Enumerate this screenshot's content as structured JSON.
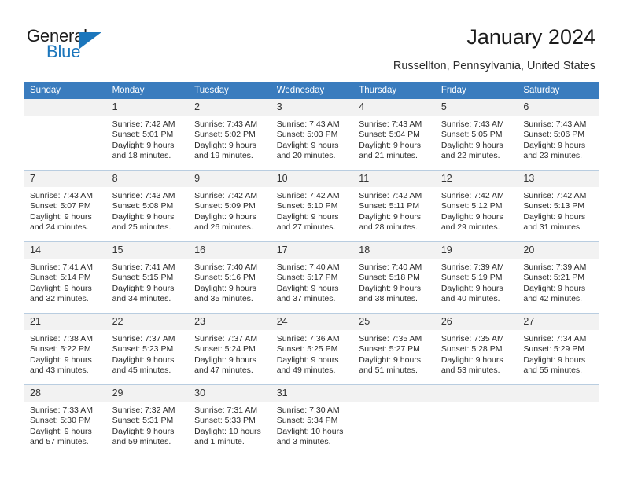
{
  "brand": {
    "name_part1": "General",
    "name_part2": "Blue",
    "logo_icon": "triangle-logo-icon",
    "accent_color": "#1b76bc"
  },
  "header": {
    "title": "January 2024",
    "location": "Russellton, Pennsylvania, United States"
  },
  "calendar": {
    "header_color": "#3a7cbe",
    "weekdays": [
      "Sunday",
      "Monday",
      "Tuesday",
      "Wednesday",
      "Thursday",
      "Friday",
      "Saturday"
    ],
    "weeks": [
      [
        {
          "day": "",
          "sunrise": "",
          "sunset": "",
          "daylight1": "",
          "daylight2": ""
        },
        {
          "day": "1",
          "sunrise": "Sunrise: 7:42 AM",
          "sunset": "Sunset: 5:01 PM",
          "daylight1": "Daylight: 9 hours",
          "daylight2": "and 18 minutes."
        },
        {
          "day": "2",
          "sunrise": "Sunrise: 7:43 AM",
          "sunset": "Sunset: 5:02 PM",
          "daylight1": "Daylight: 9 hours",
          "daylight2": "and 19 minutes."
        },
        {
          "day": "3",
          "sunrise": "Sunrise: 7:43 AM",
          "sunset": "Sunset: 5:03 PM",
          "daylight1": "Daylight: 9 hours",
          "daylight2": "and 20 minutes."
        },
        {
          "day": "4",
          "sunrise": "Sunrise: 7:43 AM",
          "sunset": "Sunset: 5:04 PM",
          "daylight1": "Daylight: 9 hours",
          "daylight2": "and 21 minutes."
        },
        {
          "day": "5",
          "sunrise": "Sunrise: 7:43 AM",
          "sunset": "Sunset: 5:05 PM",
          "daylight1": "Daylight: 9 hours",
          "daylight2": "and 22 minutes."
        },
        {
          "day": "6",
          "sunrise": "Sunrise: 7:43 AM",
          "sunset": "Sunset: 5:06 PM",
          "daylight1": "Daylight: 9 hours",
          "daylight2": "and 23 minutes."
        }
      ],
      [
        {
          "day": "7",
          "sunrise": "Sunrise: 7:43 AM",
          "sunset": "Sunset: 5:07 PM",
          "daylight1": "Daylight: 9 hours",
          "daylight2": "and 24 minutes."
        },
        {
          "day": "8",
          "sunrise": "Sunrise: 7:43 AM",
          "sunset": "Sunset: 5:08 PM",
          "daylight1": "Daylight: 9 hours",
          "daylight2": "and 25 minutes."
        },
        {
          "day": "9",
          "sunrise": "Sunrise: 7:42 AM",
          "sunset": "Sunset: 5:09 PM",
          "daylight1": "Daylight: 9 hours",
          "daylight2": "and 26 minutes."
        },
        {
          "day": "10",
          "sunrise": "Sunrise: 7:42 AM",
          "sunset": "Sunset: 5:10 PM",
          "daylight1": "Daylight: 9 hours",
          "daylight2": "and 27 minutes."
        },
        {
          "day": "11",
          "sunrise": "Sunrise: 7:42 AM",
          "sunset": "Sunset: 5:11 PM",
          "daylight1": "Daylight: 9 hours",
          "daylight2": "and 28 minutes."
        },
        {
          "day": "12",
          "sunrise": "Sunrise: 7:42 AM",
          "sunset": "Sunset: 5:12 PM",
          "daylight1": "Daylight: 9 hours",
          "daylight2": "and 29 minutes."
        },
        {
          "day": "13",
          "sunrise": "Sunrise: 7:42 AM",
          "sunset": "Sunset: 5:13 PM",
          "daylight1": "Daylight: 9 hours",
          "daylight2": "and 31 minutes."
        }
      ],
      [
        {
          "day": "14",
          "sunrise": "Sunrise: 7:41 AM",
          "sunset": "Sunset: 5:14 PM",
          "daylight1": "Daylight: 9 hours",
          "daylight2": "and 32 minutes."
        },
        {
          "day": "15",
          "sunrise": "Sunrise: 7:41 AM",
          "sunset": "Sunset: 5:15 PM",
          "daylight1": "Daylight: 9 hours",
          "daylight2": "and 34 minutes."
        },
        {
          "day": "16",
          "sunrise": "Sunrise: 7:40 AM",
          "sunset": "Sunset: 5:16 PM",
          "daylight1": "Daylight: 9 hours",
          "daylight2": "and 35 minutes."
        },
        {
          "day": "17",
          "sunrise": "Sunrise: 7:40 AM",
          "sunset": "Sunset: 5:17 PM",
          "daylight1": "Daylight: 9 hours",
          "daylight2": "and 37 minutes."
        },
        {
          "day": "18",
          "sunrise": "Sunrise: 7:40 AM",
          "sunset": "Sunset: 5:18 PM",
          "daylight1": "Daylight: 9 hours",
          "daylight2": "and 38 minutes."
        },
        {
          "day": "19",
          "sunrise": "Sunrise: 7:39 AM",
          "sunset": "Sunset: 5:19 PM",
          "daylight1": "Daylight: 9 hours",
          "daylight2": "and 40 minutes."
        },
        {
          "day": "20",
          "sunrise": "Sunrise: 7:39 AM",
          "sunset": "Sunset: 5:21 PM",
          "daylight1": "Daylight: 9 hours",
          "daylight2": "and 42 minutes."
        }
      ],
      [
        {
          "day": "21",
          "sunrise": "Sunrise: 7:38 AM",
          "sunset": "Sunset: 5:22 PM",
          "daylight1": "Daylight: 9 hours",
          "daylight2": "and 43 minutes."
        },
        {
          "day": "22",
          "sunrise": "Sunrise: 7:37 AM",
          "sunset": "Sunset: 5:23 PM",
          "daylight1": "Daylight: 9 hours",
          "daylight2": "and 45 minutes."
        },
        {
          "day": "23",
          "sunrise": "Sunrise: 7:37 AM",
          "sunset": "Sunset: 5:24 PM",
          "daylight1": "Daylight: 9 hours",
          "daylight2": "and 47 minutes."
        },
        {
          "day": "24",
          "sunrise": "Sunrise: 7:36 AM",
          "sunset": "Sunset: 5:25 PM",
          "daylight1": "Daylight: 9 hours",
          "daylight2": "and 49 minutes."
        },
        {
          "day": "25",
          "sunrise": "Sunrise: 7:35 AM",
          "sunset": "Sunset: 5:27 PM",
          "daylight1": "Daylight: 9 hours",
          "daylight2": "and 51 minutes."
        },
        {
          "day": "26",
          "sunrise": "Sunrise: 7:35 AM",
          "sunset": "Sunset: 5:28 PM",
          "daylight1": "Daylight: 9 hours",
          "daylight2": "and 53 minutes."
        },
        {
          "day": "27",
          "sunrise": "Sunrise: 7:34 AM",
          "sunset": "Sunset: 5:29 PM",
          "daylight1": "Daylight: 9 hours",
          "daylight2": "and 55 minutes."
        }
      ],
      [
        {
          "day": "28",
          "sunrise": "Sunrise: 7:33 AM",
          "sunset": "Sunset: 5:30 PM",
          "daylight1": "Daylight: 9 hours",
          "daylight2": "and 57 minutes."
        },
        {
          "day": "29",
          "sunrise": "Sunrise: 7:32 AM",
          "sunset": "Sunset: 5:31 PM",
          "daylight1": "Daylight: 9 hours",
          "daylight2": "and 59 minutes."
        },
        {
          "day": "30",
          "sunrise": "Sunrise: 7:31 AM",
          "sunset": "Sunset: 5:33 PM",
          "daylight1": "Daylight: 10 hours",
          "daylight2": "and 1 minute."
        },
        {
          "day": "31",
          "sunrise": "Sunrise: 7:30 AM",
          "sunset": "Sunset: 5:34 PM",
          "daylight1": "Daylight: 10 hours",
          "daylight2": "and 3 minutes."
        },
        {
          "day": "",
          "sunrise": "",
          "sunset": "",
          "daylight1": "",
          "daylight2": ""
        },
        {
          "day": "",
          "sunrise": "",
          "sunset": "",
          "daylight1": "",
          "daylight2": ""
        },
        {
          "day": "",
          "sunrise": "",
          "sunset": "",
          "daylight1": "",
          "daylight2": ""
        }
      ]
    ]
  }
}
